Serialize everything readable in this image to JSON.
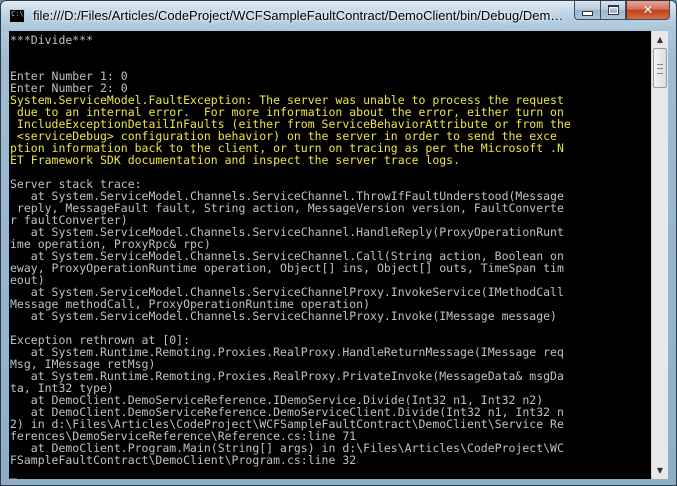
{
  "window": {
    "title": "file:///D:/Files/Articles/CodeProject/WCFSampleFaultContract/DemoClient/bin/Debug/DemoClient...",
    "minimize_icon": "minimize-icon",
    "maximize_icon": "maximize-icon",
    "close_icon": "close-icon",
    "close_glyph": "✕",
    "app_icon_text": "C:\\"
  },
  "console": {
    "lines": [
      {
        "text": "***Divide***",
        "color": "gray"
      },
      {
        "text": "",
        "color": "gray"
      },
      {
        "text": "",
        "color": "gray"
      },
      {
        "text": "Enter Number 1: 0",
        "color": "gray"
      },
      {
        "text": "Enter Number 2: 0",
        "color": "gray"
      },
      {
        "text": "System.ServiceModel.FaultException: The server was unable to process the request",
        "color": "yellow"
      },
      {
        "text": " due to an internal error.  For more information about the error, either turn on",
        "color": "yellow"
      },
      {
        "text": " IncludeExceptionDetailInFaults (either from ServiceBehaviorAttribute or from the",
        "color": "yellow"
      },
      {
        "text": " <serviceDebug> configuration behavior) on the server in order to send the exce",
        "color": "yellow"
      },
      {
        "text": "ption information back to the client, or turn on tracing as per the Microsoft .N",
        "color": "yellow"
      },
      {
        "text": "ET Framework SDK documentation and inspect the server trace logs.",
        "color": "yellow"
      },
      {
        "text": "",
        "color": "gray"
      },
      {
        "text": "Server stack trace:",
        "color": "gray"
      },
      {
        "text": "   at System.ServiceModel.Channels.ServiceChannel.ThrowIfFaultUnderstood(Message",
        "color": "gray"
      },
      {
        "text": " reply, MessageFault fault, String action, MessageVersion version, FaultConverte",
        "color": "gray"
      },
      {
        "text": "r faultConverter)",
        "color": "gray"
      },
      {
        "text": "   at System.ServiceModel.Channels.ServiceChannel.HandleReply(ProxyOperationRunt",
        "color": "gray"
      },
      {
        "text": "ime operation, ProxyRpc& rpc)",
        "color": "gray"
      },
      {
        "text": "   at System.ServiceModel.Channels.ServiceChannel.Call(String action, Boolean on",
        "color": "gray"
      },
      {
        "text": "eway, ProxyOperationRuntime operation, Object[] ins, Object[] outs, TimeSpan tim",
        "color": "gray"
      },
      {
        "text": "eout)",
        "color": "gray"
      },
      {
        "text": "   at System.ServiceModel.Channels.ServiceChannelProxy.InvokeService(IMethodCall",
        "color": "gray"
      },
      {
        "text": "Message methodCall, ProxyOperationRuntime operation)",
        "color": "gray"
      },
      {
        "text": "   at System.ServiceModel.Channels.ServiceChannelProxy.Invoke(IMessage message)",
        "color": "gray"
      },
      {
        "text": "",
        "color": "gray"
      },
      {
        "text": "Exception rethrown at [0]:",
        "color": "gray"
      },
      {
        "text": "   at System.Runtime.Remoting.Proxies.RealProxy.HandleReturnMessage(IMessage req",
        "color": "gray"
      },
      {
        "text": "Msg, IMessage retMsg)",
        "color": "gray"
      },
      {
        "text": "   at System.Runtime.Remoting.Proxies.RealProxy.PrivateInvoke(MessageData& msgDa",
        "color": "gray"
      },
      {
        "text": "ta, Int32 type)",
        "color": "gray"
      },
      {
        "text": "   at DemoClient.DemoServiceReference.IDemoService.Divide(Int32 n1, Int32 n2)",
        "color": "gray"
      },
      {
        "text": "   at DemoClient.DemoServiceReference.DemoServiceClient.Divide(Int32 n1, Int32 n",
        "color": "gray"
      },
      {
        "text": "2) in d:\\Files\\Articles\\CodeProject\\WCFSampleFaultContract\\DemoClient\\Service Re",
        "color": "gray"
      },
      {
        "text": "ferences\\DemoServiceReference\\Reference.cs:line 71",
        "color": "gray"
      },
      {
        "text": "   at DemoClient.Program.Main(String[] args) in d:\\Files\\Articles\\CodeProject\\WC",
        "color": "gray"
      },
      {
        "text": "FSampleFaultContract\\DemoClient\\Program.cs:line 32",
        "color": "gray"
      },
      {
        "text": "_",
        "color": "gray"
      }
    ]
  },
  "scrollbar": {
    "up_arrow": "▲",
    "down_arrow": "▼",
    "position_fraction": 0.0
  },
  "colors": {
    "console_background": "#000000",
    "console_text": "#c0c0c0",
    "highlight_text": "#f0e444",
    "close_button": "#c2411f"
  }
}
